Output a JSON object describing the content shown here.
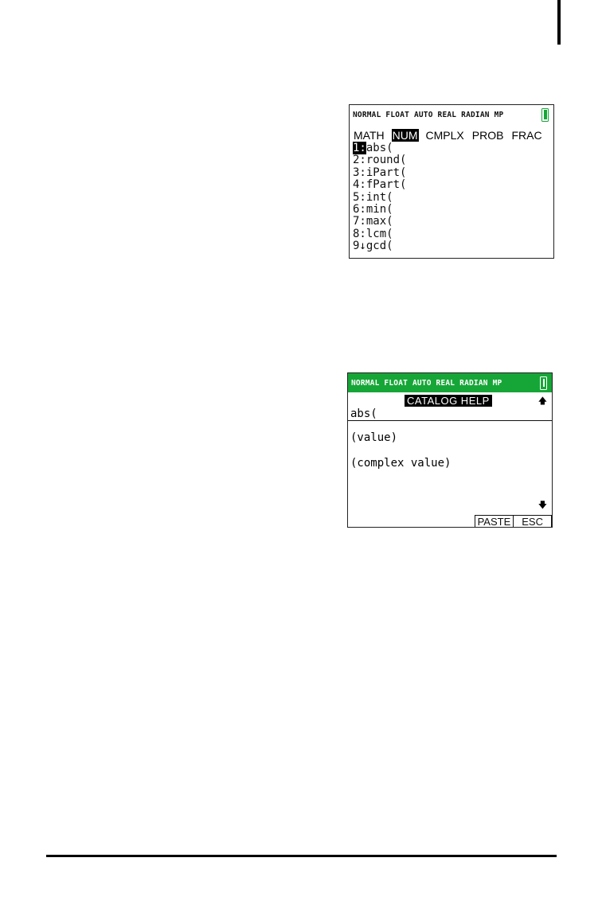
{
  "colors": {
    "status_bar_green": "#16a637",
    "battery_green": "#16a637",
    "text": "#111111"
  },
  "status_bar": {
    "text": "NORMAL FLOAT AUTO REAL RADIAN MP"
  },
  "math_menu": {
    "tabs": [
      {
        "label": "MATH",
        "active": false
      },
      {
        "label": "NUM",
        "active": true
      },
      {
        "label": "CMPLX",
        "active": false
      },
      {
        "label": "PROB",
        "active": false
      },
      {
        "label": "FRAC",
        "active": false
      }
    ],
    "items": [
      {
        "key": "1:",
        "label": "abs("
      },
      {
        "key": "2:",
        "label": "round("
      },
      {
        "key": "3:",
        "label": "iPart("
      },
      {
        "key": "4:",
        "label": "fPart("
      },
      {
        "key": "5:",
        "label": "int("
      },
      {
        "key": "6:",
        "label": "min("
      },
      {
        "key": "7:",
        "label": "max("
      },
      {
        "key": "8:",
        "label": "lcm("
      },
      {
        "key": "9↓",
        "label": "gcd("
      }
    ]
  },
  "catalog_help": {
    "title": "CATALOG HELP",
    "function": "abs(",
    "args": [
      "(value)",
      "(complex value)"
    ],
    "softkeys": {
      "paste": "PASTE",
      "esc": "ESC"
    }
  }
}
